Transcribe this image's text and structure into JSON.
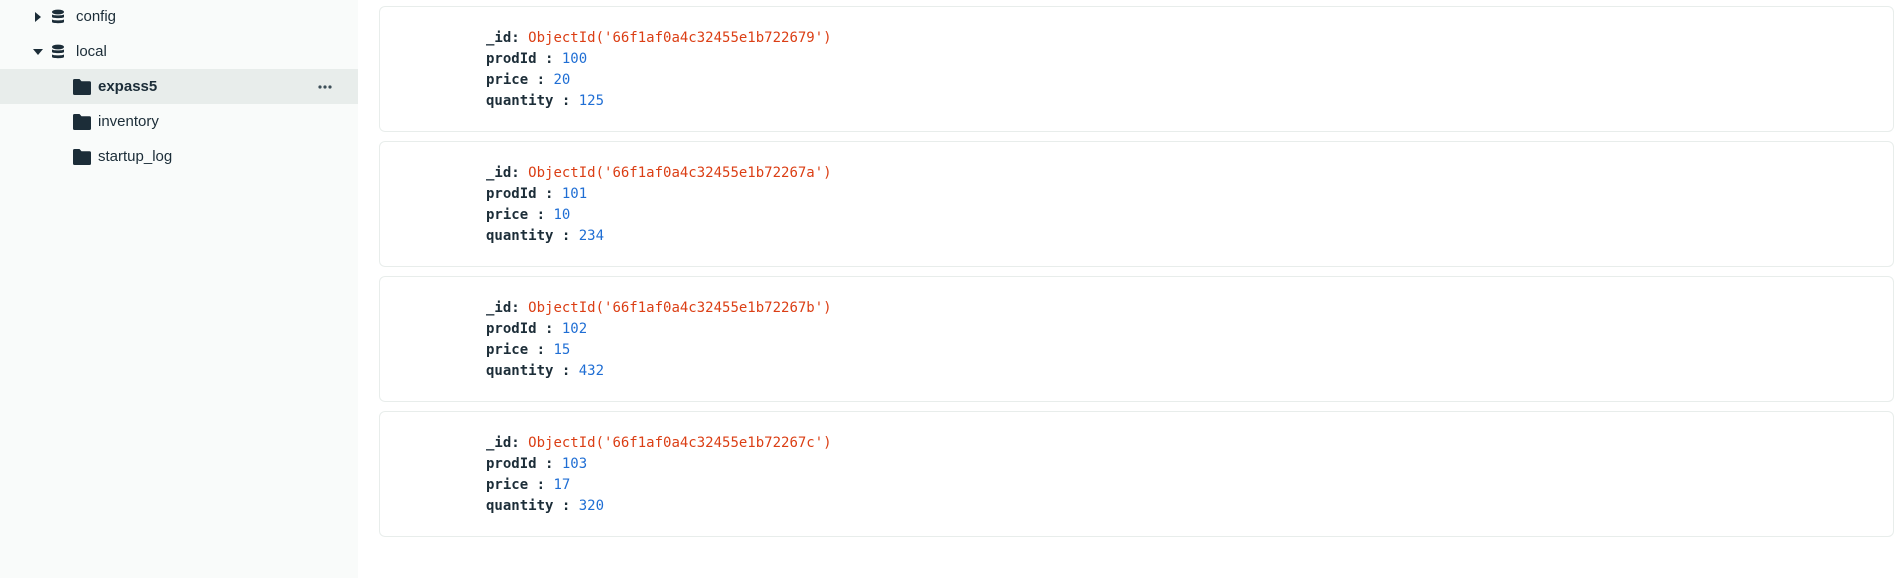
{
  "sidebar": {
    "databases": [
      {
        "name": "config",
        "expanded": false
      },
      {
        "name": "local",
        "expanded": true
      }
    ],
    "collections": [
      {
        "name": "expass5",
        "selected": true
      },
      {
        "name": "inventory",
        "selected": false
      },
      {
        "name": "startup_log",
        "selected": false
      }
    ]
  },
  "documents": [
    {
      "id_label": "_id",
      "id_value": "ObjectId('66f1af0a4c32455e1b722679')",
      "prodId_label": "prodId",
      "prodId": "100",
      "price_label": "price",
      "price": "20",
      "quantity_label": "quantity",
      "quantity": "125"
    },
    {
      "id_label": "_id",
      "id_value": "ObjectId('66f1af0a4c32455e1b72267a')",
      "prodId_label": "prodId",
      "prodId": "101",
      "price_label": "price",
      "price": "10",
      "quantity_label": "quantity",
      "quantity": "234"
    },
    {
      "id_label": "_id",
      "id_value": "ObjectId('66f1af0a4c32455e1b72267b')",
      "prodId_label": "prodId",
      "prodId": "102",
      "price_label": "price",
      "price": "15",
      "quantity_label": "quantity",
      "quantity": "432"
    },
    {
      "id_label": "_id",
      "id_value": "ObjectId('66f1af0a4c32455e1b72267c')",
      "prodId_label": "prodId",
      "prodId": "103",
      "price_label": "price",
      "price": "17",
      "quantity_label": "quantity",
      "quantity": "320"
    }
  ],
  "colors": {
    "objectid": "#db3e14",
    "number": "#1f6ed4",
    "key": "#1c2d38",
    "selected_row": "#e8edeb"
  }
}
